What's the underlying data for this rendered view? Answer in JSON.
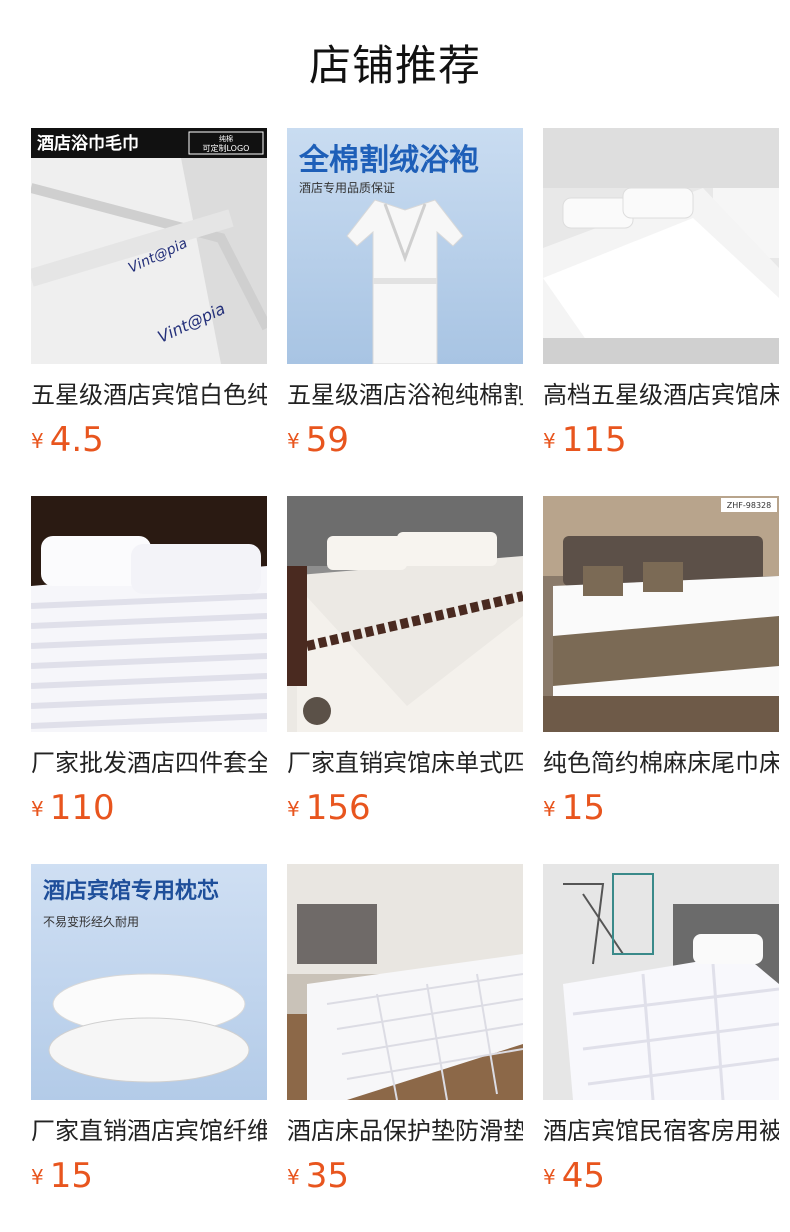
{
  "header": {
    "title": "店铺推荐"
  },
  "accent_color": "#e8551e",
  "products": [
    {
      "name": "五星级酒店宾馆白色纯棉毛巾",
      "currency": "¥",
      "price": "4.5",
      "overlay": {
        "banner": "酒店浴巾毛巾",
        "badge_1": "纯棉",
        "badge_2": "可定制LOGO",
        "logo": "Vint@pia"
      }
    },
    {
      "name": "五星级酒店浴袍纯棉割绒浴袍",
      "currency": "¥",
      "price": "59",
      "overlay": {
        "headline": "全棉割绒浴袍",
        "sub": "酒店专用品质保证"
      }
    },
    {
      "name": "高档五星级酒店宾馆床上用品",
      "currency": "¥",
      "price": "115",
      "overlay": {}
    },
    {
      "name": "厂家批发酒店四件套全棉缎条",
      "currency": "¥",
      "price": "110",
      "overlay": {}
    },
    {
      "name": "厂家直销宾馆床单式四件套",
      "currency": "¥",
      "price": "156",
      "overlay": {}
    },
    {
      "name": "纯色简约棉麻床尾巾床旗",
      "currency": "¥",
      "price": "15",
      "overlay": {
        "code": "ZHF-98328"
      }
    },
    {
      "name": "厂家直销酒店宾馆纤维枕芯",
      "currency": "¥",
      "price": "15",
      "overlay": {
        "headline": "酒店宾馆专用枕芯",
        "sub": "不易变形经久耐用"
      }
    },
    {
      "name": "酒店床品保护垫防滑垫",
      "currency": "¥",
      "price": "35",
      "overlay": {}
    },
    {
      "name": "酒店宾馆民宿客房用被芯",
      "currency": "¥",
      "price": "45",
      "overlay": {}
    }
  ]
}
